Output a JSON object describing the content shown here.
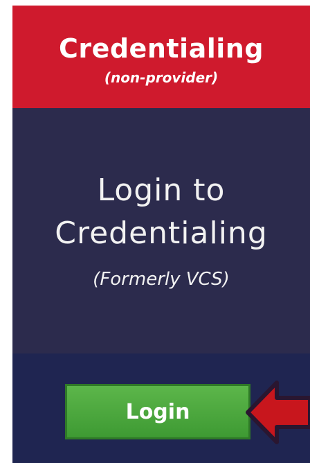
{
  "header": {
    "title": "Credentialing",
    "subtitle": "(non-provider)"
  },
  "panel": {
    "heading_line1": "Login to",
    "heading_line2": "Credentialing",
    "formerly": "(Formerly VCS)"
  },
  "footer": {
    "login_label": "Login"
  },
  "colors": {
    "header_red": "#cf1a2d",
    "panel_navy": "#2c2b4d",
    "button_green": "#4aa93c",
    "arrow_red": "#c8161d"
  }
}
